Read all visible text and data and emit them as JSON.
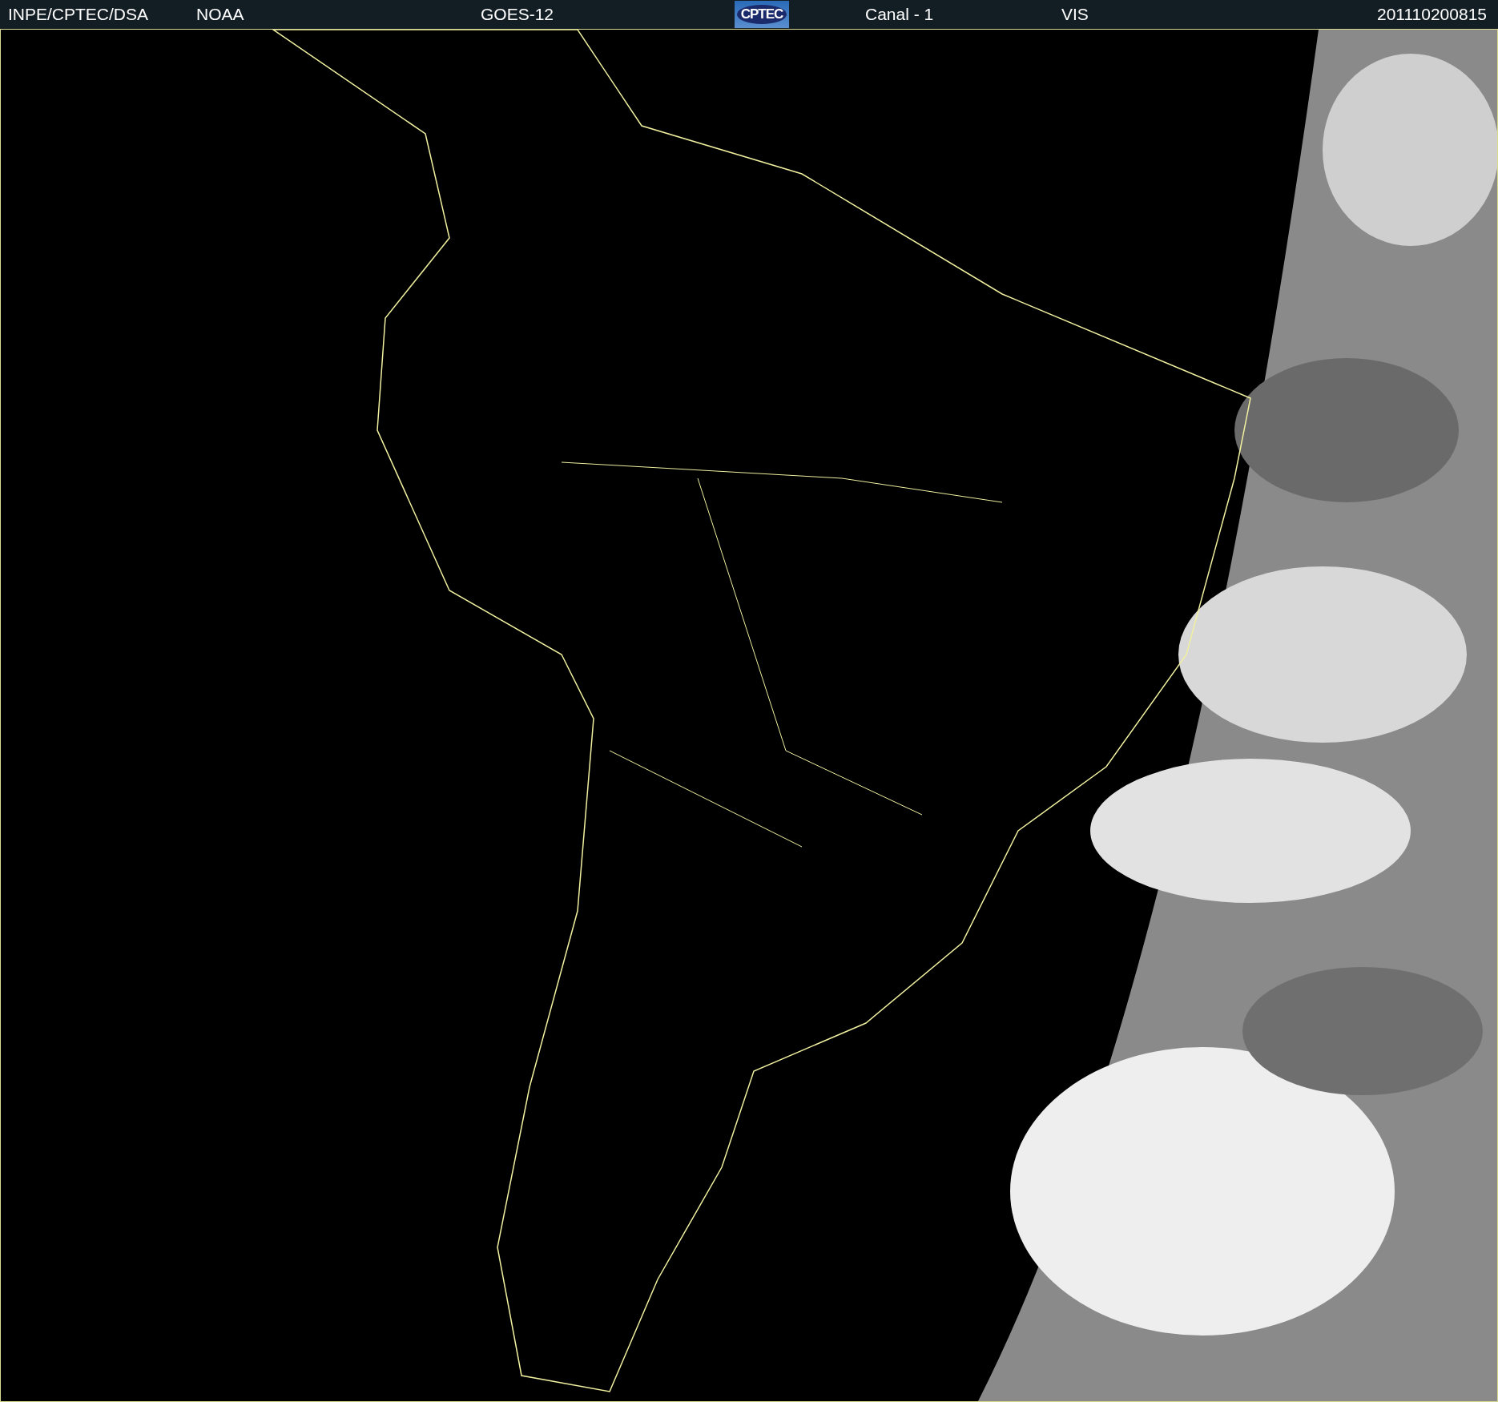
{
  "header": {
    "source": "INPE/CPTEC/DSA",
    "agency": "NOAA",
    "satellite": "GOES-12",
    "logo": "CPTEC",
    "channel": "Canal - 1",
    "band": "VIS",
    "timestamp": "201110200815"
  }
}
